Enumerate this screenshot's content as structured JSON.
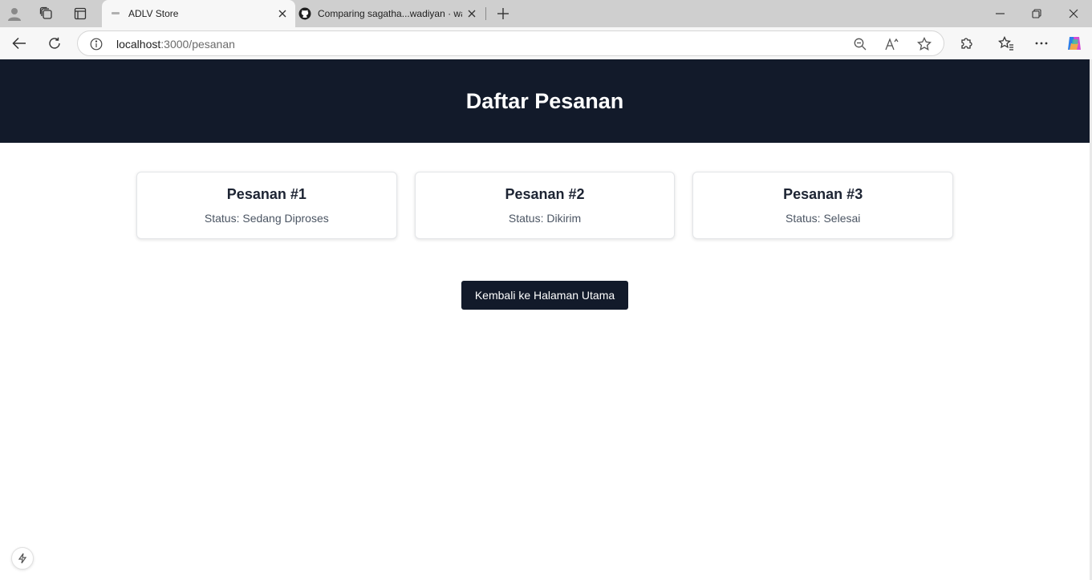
{
  "browser": {
    "tabs": [
      {
        "title": "ADLV Store",
        "active": true
      },
      {
        "title": "Comparing sagatha...wadiyan · wa",
        "active": false
      }
    ],
    "address": {
      "host": "localhost",
      "path": ":3000/pesanan"
    }
  },
  "page": {
    "header_title": "Daftar Pesanan",
    "orders": [
      {
        "title": "Pesanan #1",
        "status": "Status: Sedang Diproses"
      },
      {
        "title": "Pesanan #2",
        "status": "Status: Dikirim"
      },
      {
        "title": "Pesanan #3",
        "status": "Status: Selesai"
      }
    ],
    "back_button": "Kembali ke Halaman Utama"
  },
  "colors": {
    "header_bg": "#121a2a",
    "button_bg": "#121a2a",
    "tabstrip_bg": "#cfcfcf"
  },
  "icons": [
    "profile-icon",
    "workspaces-icon",
    "tab-actions-icon",
    "favicon-icon",
    "github-icon",
    "close-icon",
    "new-tab-icon",
    "minimize-icon",
    "restore-icon",
    "back-icon",
    "refresh-icon",
    "info-icon",
    "zoom-out-icon",
    "read-aloud-icon",
    "favorite-star-icon",
    "extensions-icon",
    "favorites-icon",
    "more-icon",
    "copilot-icon",
    "lightning-icon"
  ]
}
